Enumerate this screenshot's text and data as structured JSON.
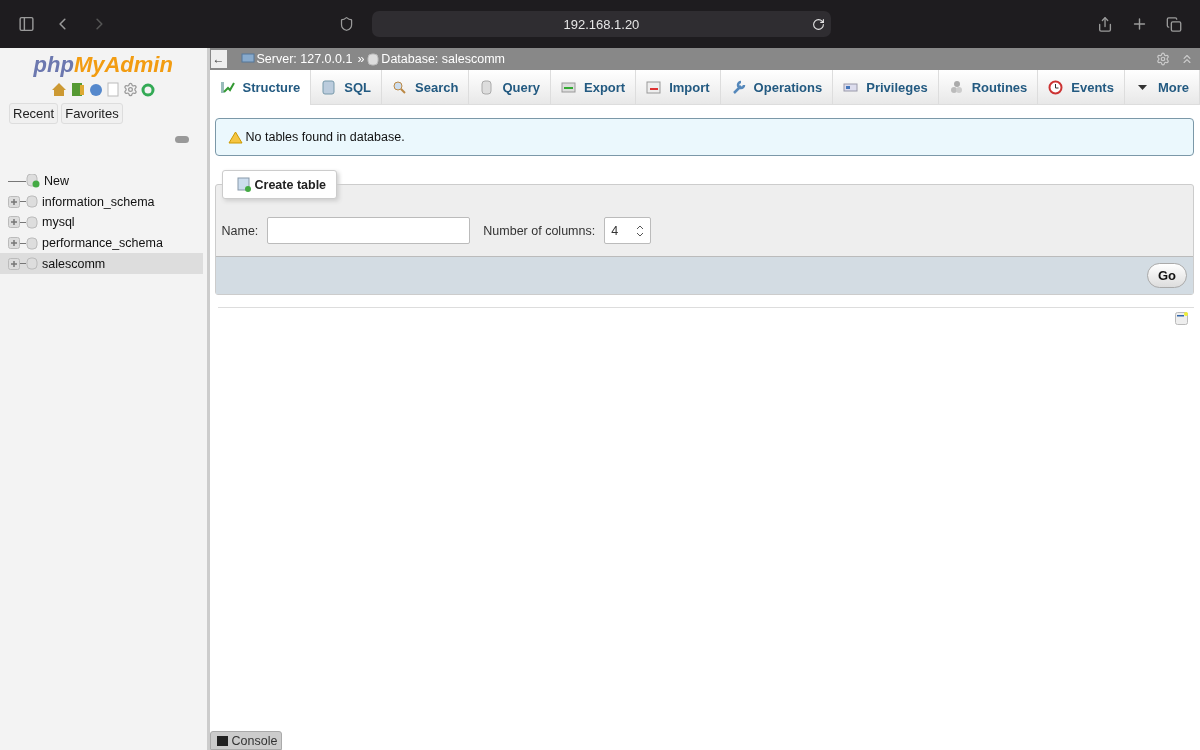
{
  "browser": {
    "address": "192.168.1.20"
  },
  "sidebar": {
    "logo": [
      "php",
      "MyAdmin"
    ],
    "tabs": [
      {
        "label": "Recent"
      },
      {
        "label": "Favorites"
      }
    ],
    "tree": [
      {
        "label": "New",
        "kind": "new",
        "selected": false
      },
      {
        "label": "information_schema",
        "kind": "database",
        "selected": false
      },
      {
        "label": "mysql",
        "kind": "database",
        "selected": false
      },
      {
        "label": "performance_schema",
        "kind": "database",
        "selected": false
      },
      {
        "label": "salescomm",
        "kind": "database",
        "selected": true
      }
    ]
  },
  "breadcrumb": {
    "back": "←",
    "server": "Server: 127.0.0.1",
    "separator": "»",
    "database": "Database: salescomm"
  },
  "tabs": [
    {
      "label": "Structure",
      "kind": "structure",
      "selected": true
    },
    {
      "label": "SQL",
      "kind": "sql",
      "selected": false
    },
    {
      "label": "Search",
      "kind": "search",
      "selected": false
    },
    {
      "label": "Query",
      "kind": "query",
      "selected": false
    },
    {
      "label": "Export",
      "kind": "export",
      "selected": false
    },
    {
      "label": "Import",
      "kind": "import",
      "selected": false
    },
    {
      "label": "Operations",
      "kind": "operations",
      "selected": false
    },
    {
      "label": "Privileges",
      "kind": "privileges",
      "selected": false
    },
    {
      "label": "Routines",
      "kind": "routines",
      "selected": false
    },
    {
      "label": "Events",
      "kind": "events",
      "selected": false
    },
    {
      "label": "More",
      "kind": "more",
      "selected": false
    }
  ],
  "notice": "No tables found in database.",
  "create_table": {
    "legend": "Create table",
    "name_label": "Name:",
    "columns_label": "Number of columns:",
    "columns_value": "4",
    "button": "Go"
  },
  "console": "Console"
}
